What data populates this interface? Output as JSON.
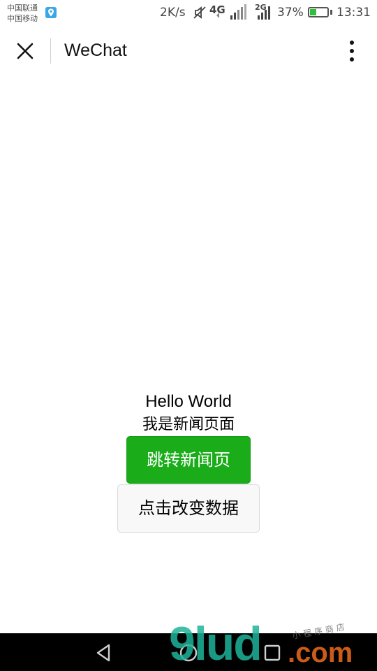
{
  "status_bar": {
    "carrier_1": "中国联通",
    "carrier_2": "中国移动",
    "net_speed": "2K/s",
    "signal_1_label": "4G",
    "signal_2_label": "2G",
    "battery_percent": "37%",
    "battery_level": 0.37,
    "time": "13:31",
    "icons": [
      "location-icon",
      "mute-icon",
      "signal-4g-icon",
      "signal-2g-icon",
      "battery-icon"
    ]
  },
  "title_bar": {
    "title": "WeChat",
    "icons": [
      "close-icon",
      "more-vertical-icon"
    ]
  },
  "main": {
    "hello_text": "Hello World",
    "news_text": "我是新闻页面",
    "primary_button_label": "跳转新闻页",
    "default_button_label": "点击改变数据"
  },
  "watermark": {
    "logo_text": "9lud",
    "logo_suffix": ".com",
    "small_text": "小程序商店"
  },
  "nav_bar": {
    "icons": [
      "back-icon",
      "home-icon",
      "recent-apps-icon"
    ]
  },
  "colors": {
    "primary_green": "#1aad19",
    "default_button_bg": "#f8f8f8",
    "nav_bar_bg": "#000000",
    "watermark_teal": "#1eb39a",
    "watermark_orange": "#e0661a"
  }
}
